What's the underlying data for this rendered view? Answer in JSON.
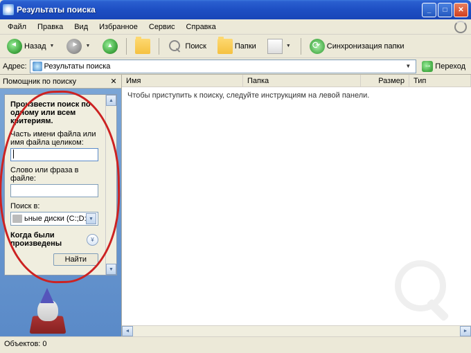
{
  "title": "Результаты поиска",
  "menu": {
    "file": "Файл",
    "edit": "Правка",
    "view": "Вид",
    "favorites": "Избранное",
    "tools": "Сервис",
    "help": "Справка"
  },
  "toolbar": {
    "back": "Назад",
    "search": "Поиск",
    "folders": "Папки",
    "sync": "Синхронизация папки"
  },
  "address": {
    "label": "Адрес:",
    "value": "Результаты поиска",
    "go": "Переход"
  },
  "sidepanel": {
    "header": "Помощник по поиску"
  },
  "search": {
    "heading": "Произвести поиск по одному или всем критериям.",
    "filename_label": "Часть имени файла или имя файла целиком:",
    "filename_value": "",
    "phrase_label": "Слово или фраза в файле:",
    "phrase_value": "",
    "lookin_label": "Поиск в:",
    "lookin_value": "ьные диски (C:;D:)",
    "when_label": "Когда были произведены",
    "find_button": "Найти"
  },
  "columns": {
    "name": "Имя",
    "folder": "Папка",
    "size": "Размер",
    "type": "Тип"
  },
  "content": {
    "hint": "Чтобы приступить к поиску, следуйте инструкциям на левой панели."
  },
  "status": {
    "objects": "Объектов: 0"
  }
}
